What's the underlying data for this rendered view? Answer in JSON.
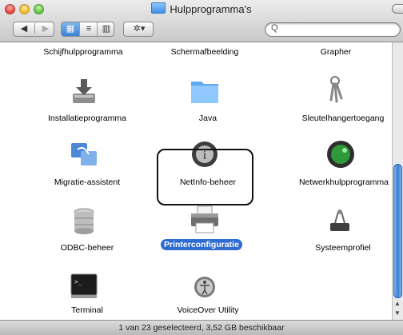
{
  "window": {
    "title": "Hulpprogramma's"
  },
  "toolbar": {
    "back": "◀",
    "forward": "▶",
    "view_icon": "▦",
    "view_list": "≡",
    "view_columns": "▥",
    "action": "✲▾",
    "search_glass": "Q",
    "search_value": ""
  },
  "items": [
    {
      "label": "Schijfhulpprogramma",
      "icon": "disk-utility-icon"
    },
    {
      "label": "Schermafbeelding",
      "icon": "grab-icon"
    },
    {
      "label": "Grapher",
      "icon": "grapher-icon"
    },
    {
      "label": "Installatieprogramma",
      "icon": "installer-icon"
    },
    {
      "label": "Java",
      "icon": "java-folder-icon"
    },
    {
      "label": "Sleutelhangertoegang",
      "icon": "keychain-icon"
    },
    {
      "label": "Migratie-assistent",
      "icon": "migration-assistant-icon"
    },
    {
      "label": "NetInfo-beheer",
      "icon": "netinfo-icon"
    },
    {
      "label": "Netwerkhulpprogramma",
      "icon": "network-utility-icon"
    },
    {
      "label": "ODBC-beheer",
      "icon": "odbc-icon"
    },
    {
      "label": "Printerconfiguratie",
      "icon": "printer-icon",
      "selected": true
    },
    {
      "label": "Systeemprofiel",
      "icon": "system-profiler-icon"
    },
    {
      "label": "Terminal",
      "icon": "terminal-icon"
    },
    {
      "label": "VoiceOver Utility",
      "icon": "voiceover-icon"
    }
  ],
  "status": {
    "text": "1 van 23 geselecteerd, 3,52 GB beschikbaar"
  },
  "colors": {
    "selection": "#2f6cd1",
    "scroll_thumb": "#3a7fd6"
  }
}
